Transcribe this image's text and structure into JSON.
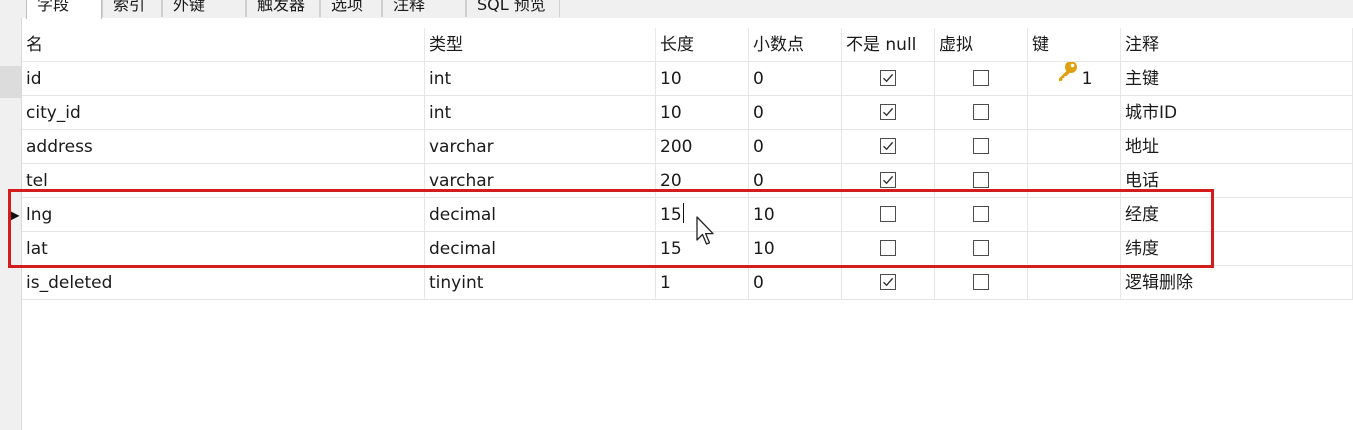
{
  "tabs": [
    "字段",
    "索引",
    "外键",
    "触发器",
    "选项",
    "注释",
    "SQL 预览"
  ],
  "columns": [
    "名",
    "类型",
    "长度",
    "小数点",
    "不是 null",
    "虚拟",
    "键",
    "注释"
  ],
  "rows": [
    {
      "name": "id",
      "type": "int",
      "length": "10",
      "decimals": "0",
      "not_null": true,
      "virtual": false,
      "key": "1",
      "comment": "主键"
    },
    {
      "name": "city_id",
      "type": "int",
      "length": "10",
      "decimals": "0",
      "not_null": true,
      "virtual": false,
      "key": "",
      "comment": "城市ID"
    },
    {
      "name": "address",
      "type": "varchar",
      "length": "200",
      "decimals": "0",
      "not_null": true,
      "virtual": false,
      "key": "",
      "comment": "地址"
    },
    {
      "name": "tel",
      "type": "varchar",
      "length": "20",
      "decimals": "0",
      "not_null": true,
      "virtual": false,
      "key": "",
      "comment": "电话"
    },
    {
      "name": "lng",
      "type": "decimal",
      "length": "15",
      "decimals": "10",
      "not_null": false,
      "virtual": false,
      "key": "",
      "comment": "经度"
    },
    {
      "name": "lat",
      "type": "decimal",
      "length": "15",
      "decimals": "10",
      "not_null": false,
      "virtual": false,
      "key": "",
      "comment": "纬度"
    },
    {
      "name": "is_deleted",
      "type": "tinyint",
      "length": "1",
      "decimals": "0",
      "not_null": true,
      "virtual": false,
      "key": "",
      "comment": "逻辑删除"
    }
  ],
  "selected_row": 4,
  "editing_field": "length",
  "colors": {
    "highlight": "#d41c1c",
    "key_icon": "#e0a010",
    "grid_line": "#e6e6e6",
    "chrome": "#f0f0f0"
  }
}
